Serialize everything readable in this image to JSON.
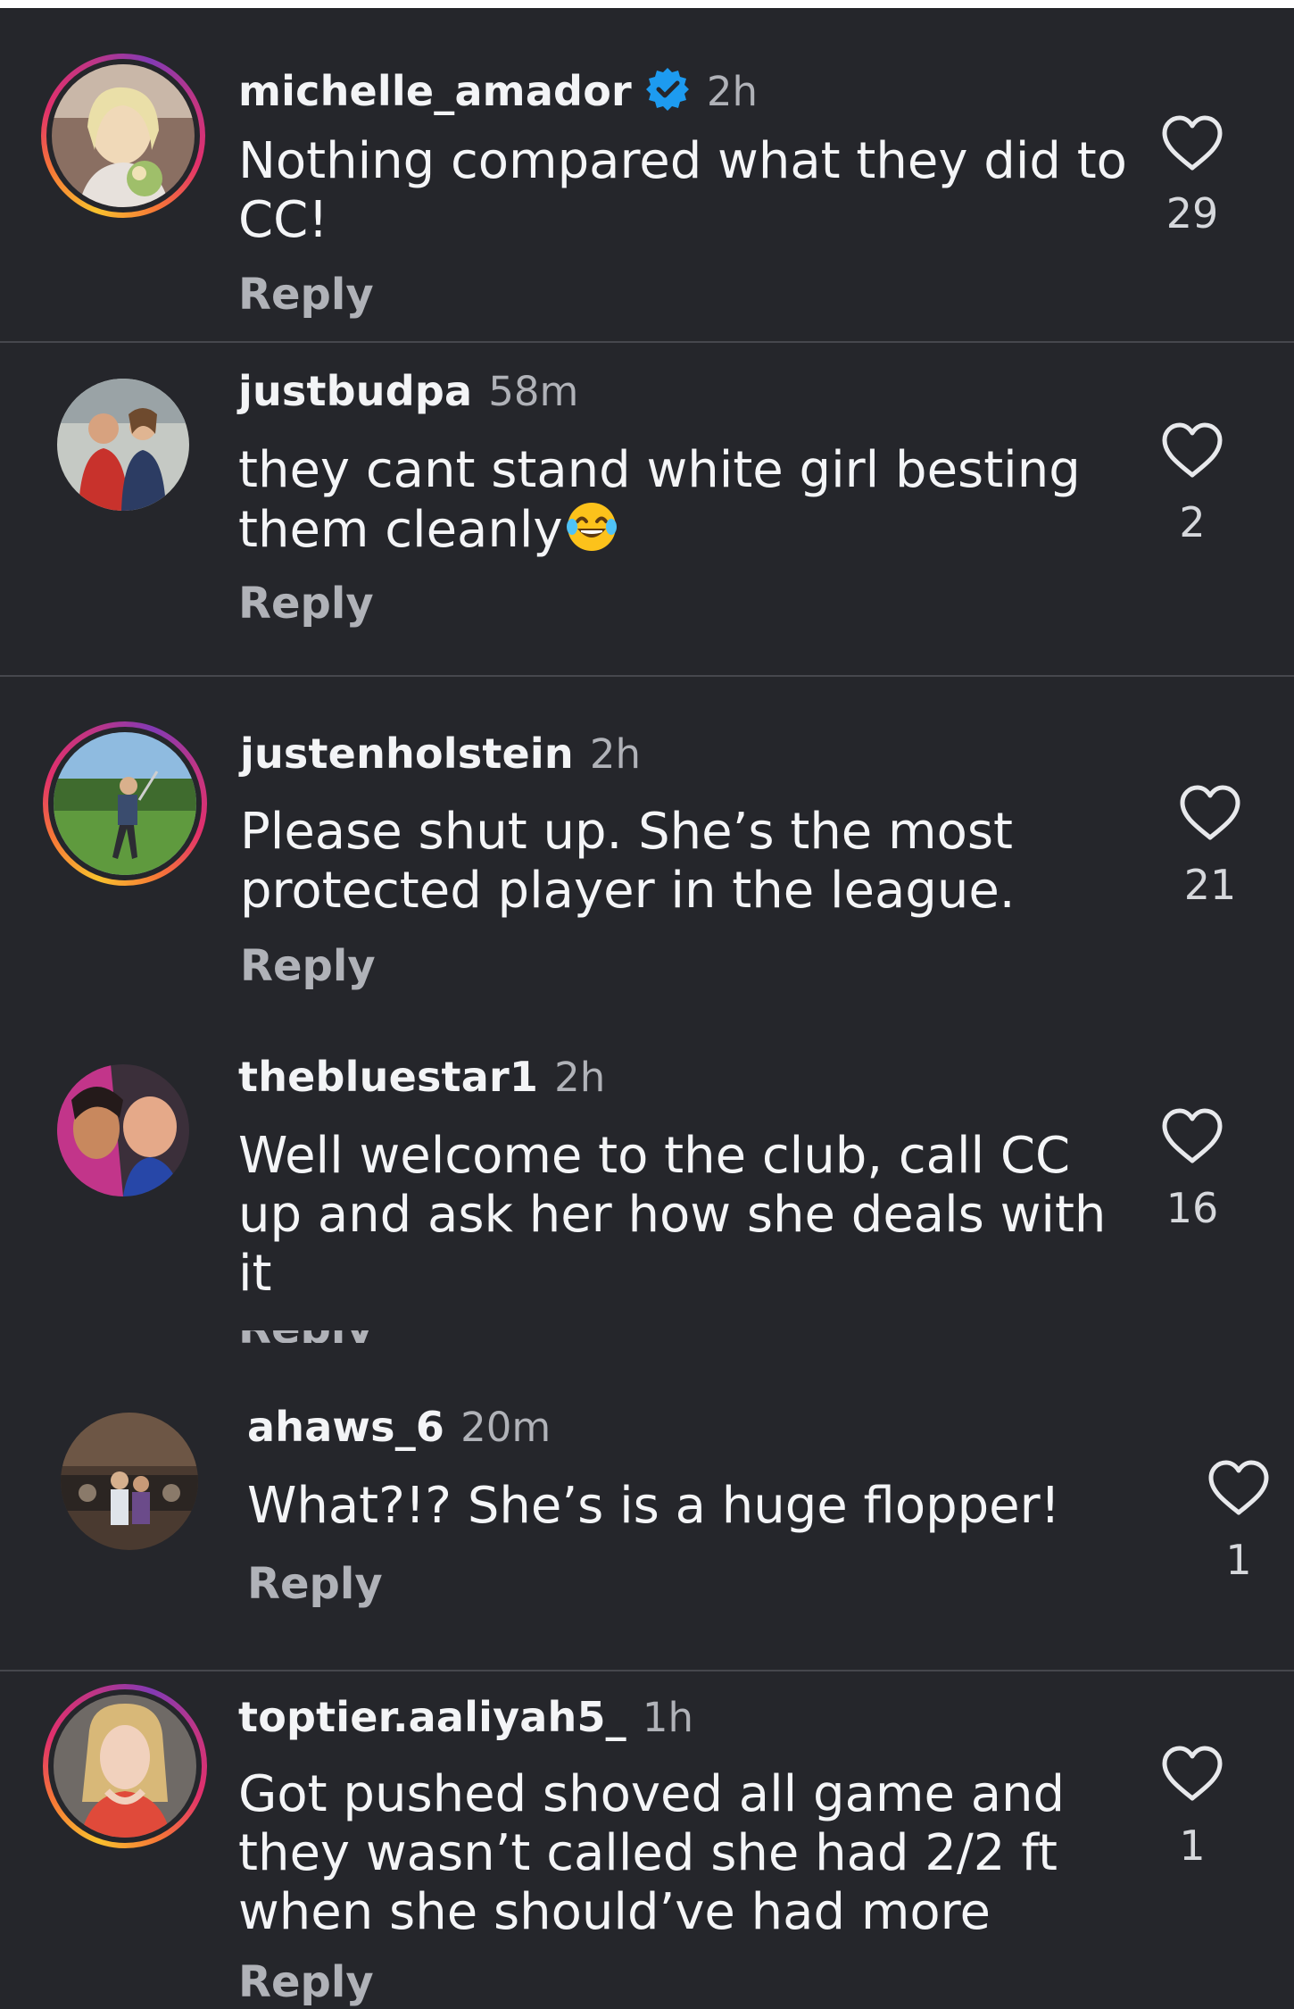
{
  "colors": {
    "background": "#25262b",
    "divider": "#46474d",
    "muted_text": "#b0b2b8",
    "verified_blue": "#1d9bf0",
    "story_ring": [
      "#f9c22e",
      "#f77737",
      "#e1306c",
      "#c13584",
      "#833ab4"
    ]
  },
  "reply_label": "Reply",
  "comments": [
    {
      "username": "michelle_amador",
      "verified": true,
      "time": "2h",
      "text_lines": [
        "Nothing compared what they did to",
        "CC!"
      ],
      "likes": "29",
      "has_story_ring": true,
      "icon": "heart-outline-icon"
    },
    {
      "username": "justbudpa",
      "verified": false,
      "time": "58m",
      "text_lines": [
        "they cant stand white girl besting",
        "them cleanly"
      ],
      "emoji": "face-with-tears-of-joy",
      "likes": "2",
      "has_story_ring": false,
      "icon": "heart-outline-icon"
    },
    {
      "username": "justenholstein",
      "verified": false,
      "time": "2h",
      "text_lines": [
        "Please shut up. She’s the most",
        "protected player in the league."
      ],
      "likes": "21",
      "has_story_ring": true,
      "icon": "heart-outline-icon"
    },
    {
      "username": "thebluestar1",
      "verified": false,
      "time": "2h",
      "text_lines": [
        "Well welcome to the club, call CC",
        "up and ask her how she deals with",
        "it"
      ],
      "likes": "16",
      "has_story_ring": false,
      "icon": "heart-outline-icon"
    },
    {
      "username": "ahaws_6",
      "verified": false,
      "time": "20m",
      "text_lines": [
        "What?!? She’s is a huge flopper!"
      ],
      "likes": "1",
      "has_story_ring": false,
      "icon": "heart-outline-icon"
    },
    {
      "username": "toptier.aaliyah5_",
      "verified": false,
      "time": "1h",
      "text_lines": [
        "Got pushed shoved all game and",
        "they wasn’t called she had 2/2 ft",
        "when she should’ve had more"
      ],
      "likes": "1",
      "has_story_ring": true,
      "icon": "heart-outline-icon"
    }
  ]
}
